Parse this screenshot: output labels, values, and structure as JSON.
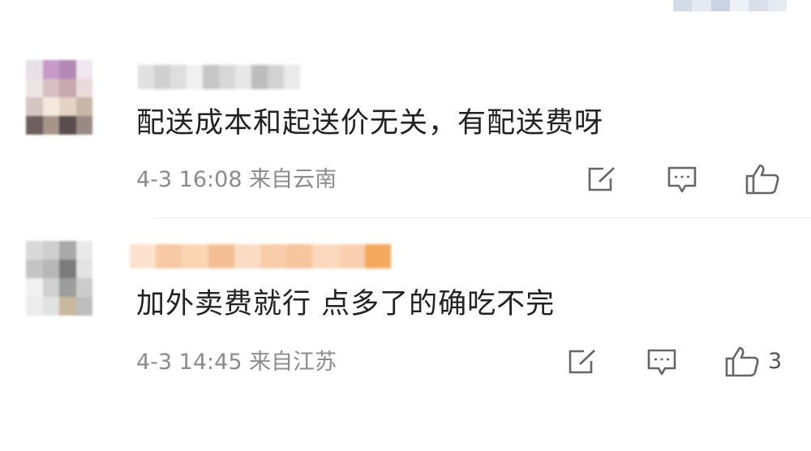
{
  "header": {
    "blur_colors": [
      "#d3dbe8",
      "#e4eaf2",
      "#c9d3e2",
      "#eef1f6",
      "#d8dfe9",
      "#e6ebf1"
    ]
  },
  "comments": [
    {
      "text": "配送成本和起送价无关，有配送费呀",
      "date": "4-3 16:08",
      "location": "来自云南",
      "likes": "",
      "avatar_colors": [
        "#e8dfe9",
        "#c79ac8",
        "#b38ab5",
        "#f0e6ee",
        "#efe4e4",
        "#d7c0c4",
        "#c7a8ad",
        "#eadadb",
        "#d4c6c1",
        "#f3e9df",
        "#e5d4c6",
        "#c8b6a8",
        "#6d5f5f",
        "#a7948a",
        "#5a4d4e",
        "#9a8a86"
      ],
      "username_colors": [
        "#e0e0e0",
        "#cfcfcf",
        "#dedede",
        "#f0f0f0",
        "#c6c6c6",
        "#d7d7d7",
        "#e7e7e7",
        "#bdbdbd",
        "#d2d2d2",
        "#eaeaea"
      ]
    },
    {
      "text": "加外卖费就行 点多了的确吃不完",
      "date": "4-3 14:45",
      "location": "来自江苏",
      "likes": "3",
      "avatar_colors": [
        "#d9d9d9",
        "#cfcfcf",
        "#a9a9a9",
        "#e9e9e9",
        "#c4c4c4",
        "#b7b7b7",
        "#7c7c7c",
        "#e3e3e3",
        "#f1f1f1",
        "#d0d0d0",
        "#9d9d9d",
        "#cccccc",
        "#ececec",
        "#e1e1e1",
        "#c9b79f",
        "#bdbdbd"
      ],
      "username_colors": [
        "#fde3cf",
        "#f7c9a4",
        "#fbd4b4",
        "#f5bf95",
        "#fadcc5",
        "#f8cdaa",
        "#f6c49d",
        "#fbd9bf",
        "#f9d0b1",
        "#f3a95e"
      ]
    }
  ],
  "icons": {
    "share": "share-icon",
    "comment": "comment-icon",
    "like": "thumbs-up-icon"
  }
}
